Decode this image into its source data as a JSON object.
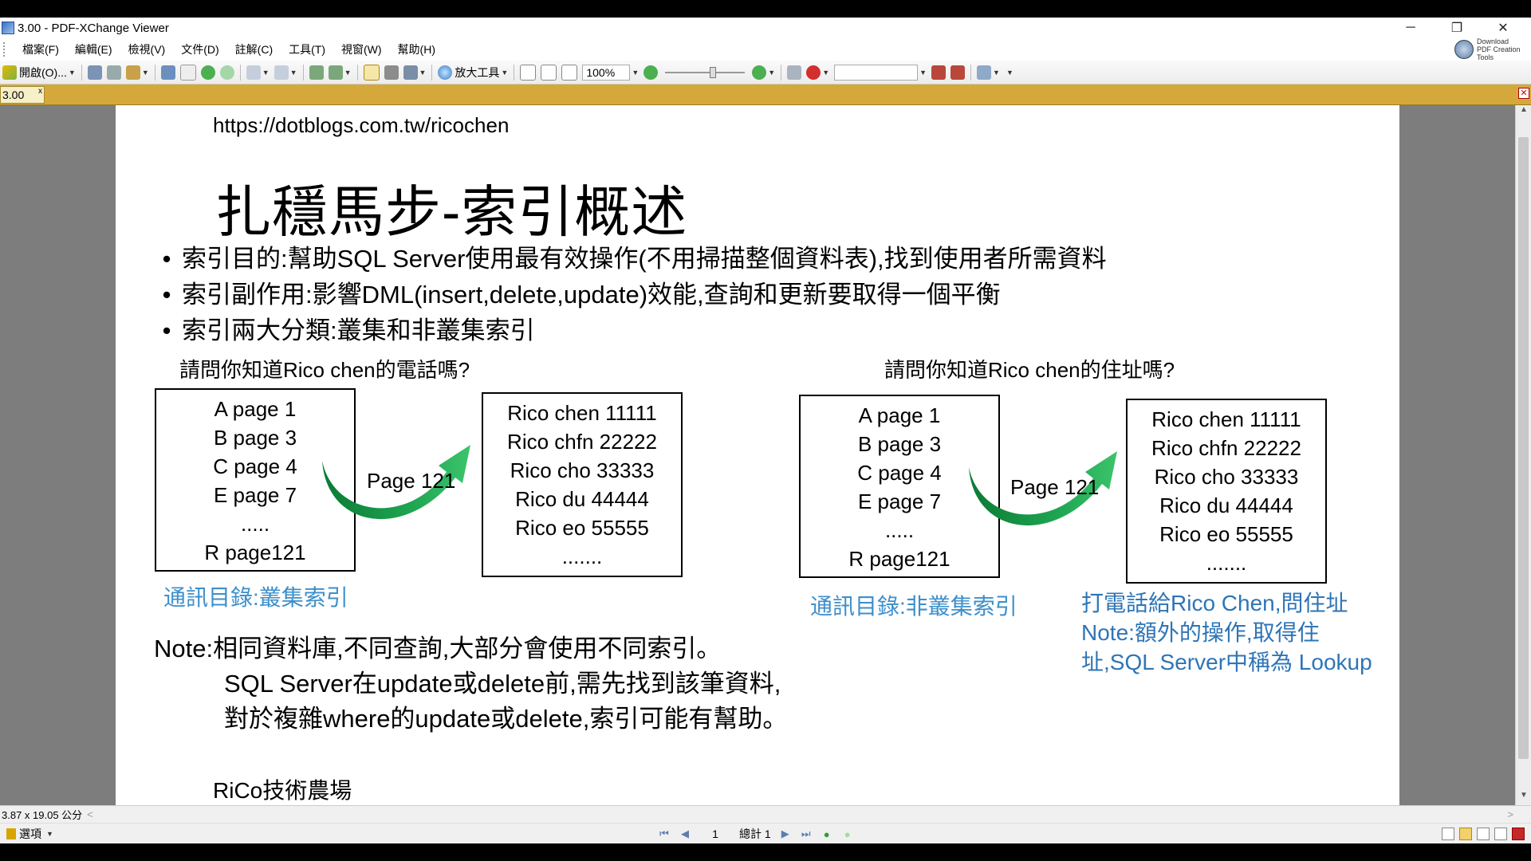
{
  "window": {
    "title": "3.00 - PDF-XChange Viewer",
    "controls": {
      "minimize": "─",
      "restore": "❐",
      "close": "✕"
    }
  },
  "menu": {
    "items": [
      "檔案(F)",
      "編輯(E)",
      "檢視(V)",
      "文件(D)",
      "註解(C)",
      "工具(T)",
      "視窗(W)",
      "幫助(H)"
    ],
    "download_tools": "Download PDF Creation Tools"
  },
  "toolbar": {
    "open_label": "開啟(O)...",
    "zoom_tool_label": "放大工具",
    "zoom_value": "100%",
    "search_placeholder": ""
  },
  "tab": {
    "label": "3.00",
    "close": "x"
  },
  "document": {
    "url": "https://dotblogs.com.tw/ricochen",
    "title": "扎穩馬步-索引概述",
    "bullet_symbol": "•",
    "bullets": [
      "索引目的:幫助SQL Server使用最有效操作(不用掃描整個資料表),找到使用者所需資料",
      "索引副作用:影響DML(insert,delete,update)效能,查詢和更新要取得一個平衡",
      "索引兩大分類:叢集和非叢集索引"
    ],
    "left": {
      "question": "請問你知道Rico chen的電話嗎?",
      "index_lines": [
        "A  page 1",
        "B page 3",
        "C page 4",
        "E page 7",
        ".....",
        "R page121"
      ],
      "data_lines": [
        "Rico chen 11111",
        "Rico chfn 22222",
        "Rico cho 33333",
        "Rico du 44444",
        "Rico eo 55555",
        "......."
      ],
      "arrow_label": "Page 121",
      "caption": "通訊目錄:叢集索引"
    },
    "right": {
      "question": "請問你知道Rico chen的住址嗎?",
      "index_lines": [
        "A  page 1",
        "B page 3",
        "C page 4",
        "E page 7",
        ".....",
        "R page121"
      ],
      "data_lines": [
        "Rico chen 11111",
        "Rico chfn 22222",
        "Rico cho 33333",
        "Rico du 44444",
        "Rico eo 55555",
        "......."
      ],
      "arrow_label": "Page 121",
      "caption": "通訊目錄:非叢集索引",
      "note_lines": [
        "打電話給Rico Chen,問住址",
        "Note:額外的操作,取得住",
        "址,SQL Server中稱為 Lookup"
      ]
    },
    "note_lines": [
      "Note:相同資料庫,不同查詢,大部分會使用不同索引。",
      "SQL Server在update或delete前,需先找到該筆資料,",
      "對於複雜where的update或delete,索引可能有幫助。"
    ],
    "footer": "RiCo技術農場"
  },
  "status": {
    "page_size": "3.87 x 19.05 公分"
  },
  "navigation": {
    "options_label": "選項",
    "current_page": "1",
    "total_label": "總計 1"
  },
  "colors": {
    "arrow_green": "#1e9e4a",
    "caption_blue": "#3d8fcb",
    "note_blue": "#2e75b6",
    "tab_bar": "#d4a83a"
  }
}
